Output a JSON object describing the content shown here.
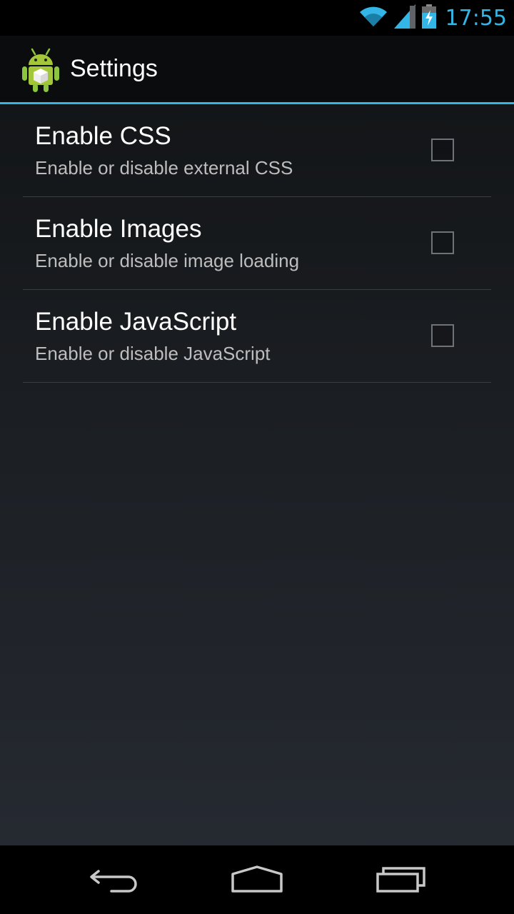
{
  "status_bar": {
    "time": "17:55",
    "icons": [
      "wifi-icon",
      "signal-icon",
      "battery-charging-icon"
    ],
    "accent_color": "#33b5e5"
  },
  "action_bar": {
    "title": "Settings",
    "icon": "android-app-icon",
    "divider_color": "#33b5e5"
  },
  "preferences": [
    {
      "title": "Enable CSS",
      "summary": "Enable or disable external CSS",
      "checked": false
    },
    {
      "title": "Enable Images",
      "summary": "Enable or disable image loading",
      "checked": false
    },
    {
      "title": "Enable JavaScript",
      "summary": "Enable or disable JavaScript",
      "checked": false
    }
  ],
  "nav_bar": {
    "buttons": [
      "back-icon",
      "home-icon",
      "recent-apps-icon"
    ]
  }
}
